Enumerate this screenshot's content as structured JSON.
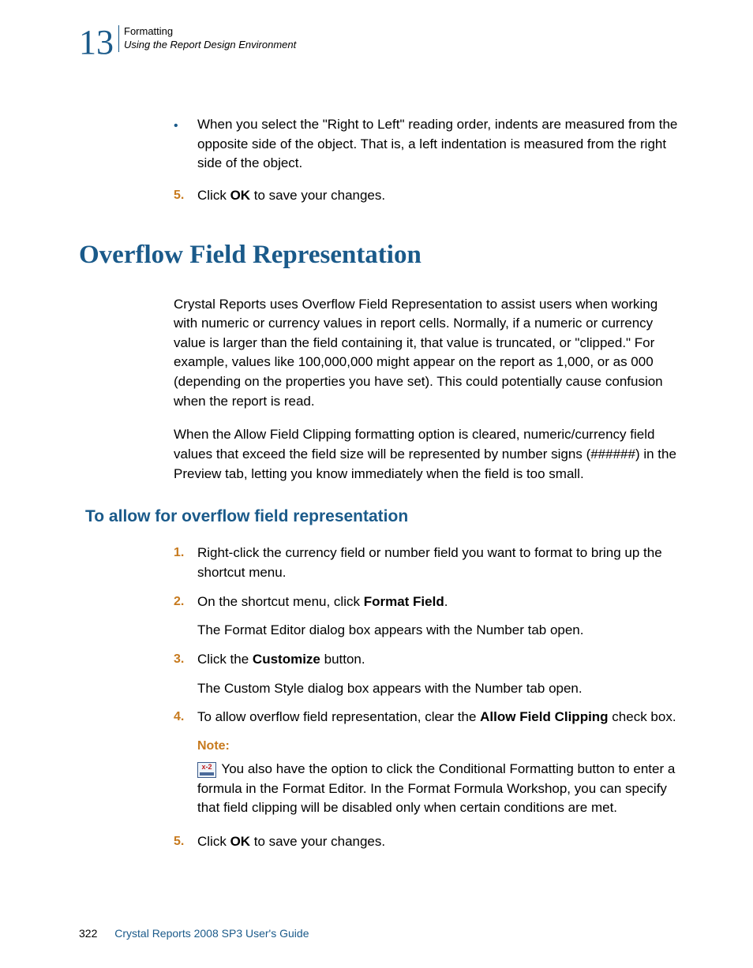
{
  "header": {
    "chapter_num": "13",
    "chapter_title": "Formatting",
    "section_title": "Using the Report Design Environment"
  },
  "top_bullet": "When you select the \"Right to Left\" reading order, indents are measured from the opposite side of the object. That is, a left indentation is measured from the right side of the object.",
  "top_step5_num": "5.",
  "top_step5_a": "Click ",
  "top_step5_b": "OK",
  "top_step5_c": " to save your changes.",
  "h1": "Overflow Field Representation",
  "p1": "Crystal Reports uses Overflow Field Representation to assist users when working with numeric or currency values in report cells. Normally, if a numeric or currency value is larger than the field containing it, that value is truncated, or \"clipped.\" For example, values like 100,000,000 might appear on the report as 1,000, or as 000 (depending on the properties you have set). This could potentially cause confusion when the report is read.",
  "p2": "When the Allow Field Clipping formatting option is cleared, numeric/currency field values that exceed the field size will be represented by number signs (######) in the Preview tab, letting you know immediately when the field is too small.",
  "h2": "To allow for overflow field representation",
  "s1_num": "1.",
  "s1": "Right-click the currency field or number field you want to format to bring up the shortcut menu.",
  "s2_num": "2.",
  "s2_a": "On the shortcut menu, click ",
  "s2_b": "Format Field",
  "s2_c": ".",
  "s2_sub": "The Format Editor dialog box appears with the Number tab open.",
  "s3_num": "3.",
  "s3_a": "Click the ",
  "s3_b": "Customize",
  "s3_c": " button.",
  "s3_sub": "The Custom Style dialog box appears with the Number tab open.",
  "s4_num": "4.",
  "s4_a": "To allow overflow field representation, clear the ",
  "s4_b": "Allow Field Clipping",
  "s4_c": " check box.",
  "note_label": "Note:",
  "note_text": " You also have the option to click the Conditional Formatting button to enter a formula in the Format Editor. In the Format Formula Workshop, you can specify that field clipping will be disabled only when certain conditions are met.",
  "s5_num": "5.",
  "s5_a": "Click ",
  "s5_b": "OK",
  "s5_c": " to save your changes.",
  "footer": {
    "page_num": "322",
    "doc_title": "Crystal Reports 2008 SP3 User's Guide"
  },
  "icon_label": "x-2"
}
